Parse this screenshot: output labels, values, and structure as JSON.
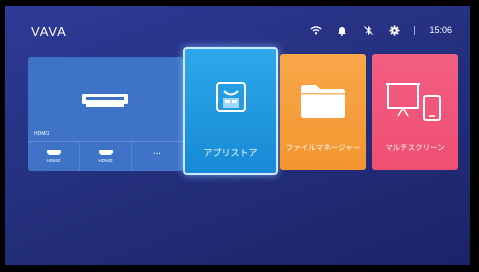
{
  "header": {
    "brand": "VAVA",
    "time": "15:06",
    "status_icons": [
      "wifi-icon",
      "notification-bell-icon",
      "bluetooth-off-icon",
      "settings-gear-icon"
    ]
  },
  "tiles": {
    "hdmi": {
      "label": "HDMI1",
      "sub_inputs": [
        {
          "label": "HDMI2",
          "icon": "hdmi-port-icon"
        },
        {
          "label": "HDMI3",
          "icon": "hdmi-port-icon"
        },
        {
          "label": "•••",
          "icon": "more-dots-icon"
        }
      ],
      "color": "#3f73c8"
    },
    "apps": {
      "label": "アプリストア",
      "icon": "app-store-bag-icon",
      "color": "#2ea8ea"
    },
    "file_manager": {
      "label": "ファイルマネージャー",
      "icon": "folder-icon",
      "color": "#f8a749"
    },
    "multi_screen": {
      "label": "マルチスクリーン",
      "icon": "screen-mirroring-icon",
      "color": "#f25e82"
    }
  }
}
